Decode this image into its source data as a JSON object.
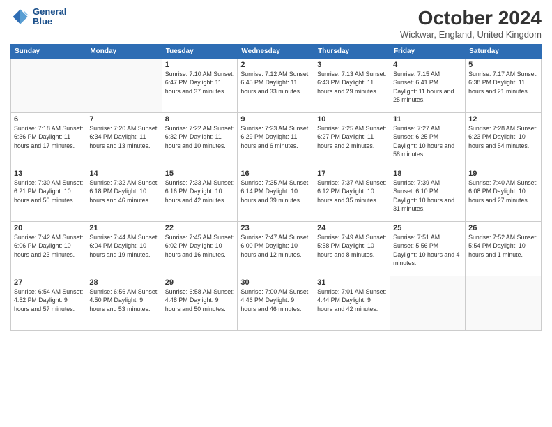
{
  "logo": {
    "line1": "General",
    "line2": "Blue"
  },
  "title": "October 2024",
  "location": "Wickwar, England, United Kingdom",
  "days_of_week": [
    "Sunday",
    "Monday",
    "Tuesday",
    "Wednesday",
    "Thursday",
    "Friday",
    "Saturday"
  ],
  "weeks": [
    [
      {
        "day": "",
        "info": ""
      },
      {
        "day": "",
        "info": ""
      },
      {
        "day": "1",
        "info": "Sunrise: 7:10 AM\nSunset: 6:47 PM\nDaylight: 11 hours and 37 minutes."
      },
      {
        "day": "2",
        "info": "Sunrise: 7:12 AM\nSunset: 6:45 PM\nDaylight: 11 hours and 33 minutes."
      },
      {
        "day": "3",
        "info": "Sunrise: 7:13 AM\nSunset: 6:43 PM\nDaylight: 11 hours and 29 minutes."
      },
      {
        "day": "4",
        "info": "Sunrise: 7:15 AM\nSunset: 6:41 PM\nDaylight: 11 hours and 25 minutes."
      },
      {
        "day": "5",
        "info": "Sunrise: 7:17 AM\nSunset: 6:38 PM\nDaylight: 11 hours and 21 minutes."
      }
    ],
    [
      {
        "day": "6",
        "info": "Sunrise: 7:18 AM\nSunset: 6:36 PM\nDaylight: 11 hours and 17 minutes."
      },
      {
        "day": "7",
        "info": "Sunrise: 7:20 AM\nSunset: 6:34 PM\nDaylight: 11 hours and 13 minutes."
      },
      {
        "day": "8",
        "info": "Sunrise: 7:22 AM\nSunset: 6:32 PM\nDaylight: 11 hours and 10 minutes."
      },
      {
        "day": "9",
        "info": "Sunrise: 7:23 AM\nSunset: 6:29 PM\nDaylight: 11 hours and 6 minutes."
      },
      {
        "day": "10",
        "info": "Sunrise: 7:25 AM\nSunset: 6:27 PM\nDaylight: 11 hours and 2 minutes."
      },
      {
        "day": "11",
        "info": "Sunrise: 7:27 AM\nSunset: 6:25 PM\nDaylight: 10 hours and 58 minutes."
      },
      {
        "day": "12",
        "info": "Sunrise: 7:28 AM\nSunset: 6:23 PM\nDaylight: 10 hours and 54 minutes."
      }
    ],
    [
      {
        "day": "13",
        "info": "Sunrise: 7:30 AM\nSunset: 6:21 PM\nDaylight: 10 hours and 50 minutes."
      },
      {
        "day": "14",
        "info": "Sunrise: 7:32 AM\nSunset: 6:18 PM\nDaylight: 10 hours and 46 minutes."
      },
      {
        "day": "15",
        "info": "Sunrise: 7:33 AM\nSunset: 6:16 PM\nDaylight: 10 hours and 42 minutes."
      },
      {
        "day": "16",
        "info": "Sunrise: 7:35 AM\nSunset: 6:14 PM\nDaylight: 10 hours and 39 minutes."
      },
      {
        "day": "17",
        "info": "Sunrise: 7:37 AM\nSunset: 6:12 PM\nDaylight: 10 hours and 35 minutes."
      },
      {
        "day": "18",
        "info": "Sunrise: 7:39 AM\nSunset: 6:10 PM\nDaylight: 10 hours and 31 minutes."
      },
      {
        "day": "19",
        "info": "Sunrise: 7:40 AM\nSunset: 6:08 PM\nDaylight: 10 hours and 27 minutes."
      }
    ],
    [
      {
        "day": "20",
        "info": "Sunrise: 7:42 AM\nSunset: 6:06 PM\nDaylight: 10 hours and 23 minutes."
      },
      {
        "day": "21",
        "info": "Sunrise: 7:44 AM\nSunset: 6:04 PM\nDaylight: 10 hours and 19 minutes."
      },
      {
        "day": "22",
        "info": "Sunrise: 7:45 AM\nSunset: 6:02 PM\nDaylight: 10 hours and 16 minutes."
      },
      {
        "day": "23",
        "info": "Sunrise: 7:47 AM\nSunset: 6:00 PM\nDaylight: 10 hours and 12 minutes."
      },
      {
        "day": "24",
        "info": "Sunrise: 7:49 AM\nSunset: 5:58 PM\nDaylight: 10 hours and 8 minutes."
      },
      {
        "day": "25",
        "info": "Sunrise: 7:51 AM\nSunset: 5:56 PM\nDaylight: 10 hours and 4 minutes."
      },
      {
        "day": "26",
        "info": "Sunrise: 7:52 AM\nSunset: 5:54 PM\nDaylight: 10 hours and 1 minute."
      }
    ],
    [
      {
        "day": "27",
        "info": "Sunrise: 6:54 AM\nSunset: 4:52 PM\nDaylight: 9 hours and 57 minutes."
      },
      {
        "day": "28",
        "info": "Sunrise: 6:56 AM\nSunset: 4:50 PM\nDaylight: 9 hours and 53 minutes."
      },
      {
        "day": "29",
        "info": "Sunrise: 6:58 AM\nSunset: 4:48 PM\nDaylight: 9 hours and 50 minutes."
      },
      {
        "day": "30",
        "info": "Sunrise: 7:00 AM\nSunset: 4:46 PM\nDaylight: 9 hours and 46 minutes."
      },
      {
        "day": "31",
        "info": "Sunrise: 7:01 AM\nSunset: 4:44 PM\nDaylight: 9 hours and 42 minutes."
      },
      {
        "day": "",
        "info": ""
      },
      {
        "day": "",
        "info": ""
      }
    ]
  ]
}
